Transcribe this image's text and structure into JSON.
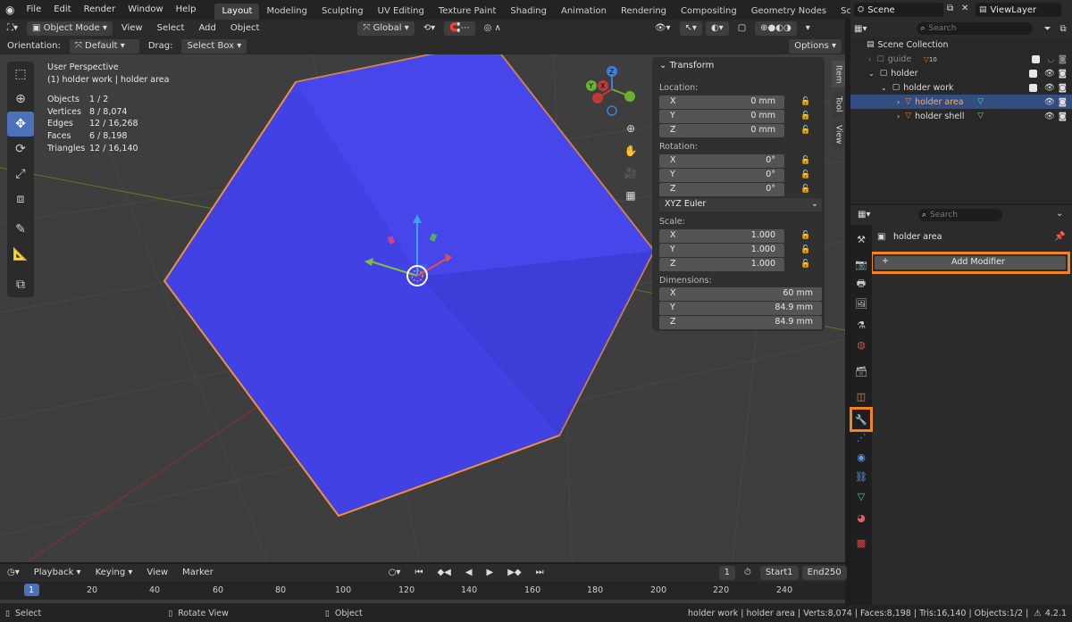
{
  "menu": {
    "items": [
      "File",
      "Edit",
      "Render",
      "Window",
      "Help"
    ],
    "workspaces": [
      "Layout",
      "Modeling",
      "Sculpting",
      "UV Editing",
      "Texture Paint",
      "Shading",
      "Animation",
      "Rendering",
      "Compositing",
      "Geometry Nodes",
      "Scripting"
    ],
    "active_workspace": "Layout",
    "add_tab": "+",
    "scene": "Scene",
    "view_layer": "ViewLayer"
  },
  "viewport_header": {
    "mode": "Object Mode",
    "view": "View",
    "select": "Select",
    "add": "Add",
    "object": "Object",
    "transform_orientation": "Global",
    "orientation_label": "Orientation:",
    "orientation_value": "Default",
    "drag_label": "Drag:",
    "drag_value": "Select Box",
    "options": "Options"
  },
  "viewport_info": {
    "perspective": "User Perspective",
    "context": "(1) holder work | holder area",
    "stats": [
      {
        "k": "Objects",
        "v": "1 / 2"
      },
      {
        "k": "Vertices",
        "v": "8 / 8,074"
      },
      {
        "k": "Edges",
        "v": "12 / 16,268"
      },
      {
        "k": "Faces",
        "v": "6 / 8,198"
      },
      {
        "k": "Triangles",
        "v": "12 / 16,140"
      }
    ]
  },
  "gizmo": {
    "x": "X",
    "y": "Y",
    "z": "Z"
  },
  "transform_panel": {
    "title": "Transform",
    "location_label": "Location:",
    "location": [
      {
        "axis": "X",
        "value": "0 mm"
      },
      {
        "axis": "Y",
        "value": "0 mm"
      },
      {
        "axis": "Z",
        "value": "0 mm"
      }
    ],
    "rotation_label": "Rotation:",
    "rotation": [
      {
        "axis": "X",
        "value": "0°"
      },
      {
        "axis": "Y",
        "value": "0°"
      },
      {
        "axis": "Z",
        "value": "0°"
      }
    ],
    "rotation_mode": "XYZ Euler",
    "scale_label": "Scale:",
    "scale": [
      {
        "axis": "X",
        "value": "1.000"
      },
      {
        "axis": "Y",
        "value": "1.000"
      },
      {
        "axis": "Z",
        "value": "1.000"
      }
    ],
    "dimensions_label": "Dimensions:",
    "dimensions": [
      {
        "axis": "X",
        "value": "60 mm"
      },
      {
        "axis": "Y",
        "value": "84.9 mm"
      },
      {
        "axis": "Z",
        "value": "84.9 mm"
      }
    ]
  },
  "side_tabs": [
    "Item",
    "Tool",
    "View"
  ],
  "outliner": {
    "search_placeholder": "Search",
    "rows": [
      {
        "label": "Scene Collection"
      },
      {
        "label": "guide",
        "badge": "10"
      },
      {
        "label": "holder"
      },
      {
        "label": "holder work"
      },
      {
        "label": "holder area"
      },
      {
        "label": "holder shell"
      }
    ]
  },
  "properties": {
    "search_placeholder": "Search",
    "object_name": "holder area",
    "add_modifier": "Add Modifier",
    "add_plus": "+"
  },
  "timeline": {
    "playback": "Playback",
    "keying": "Keying",
    "view": "View",
    "marker": "Marker",
    "current_frame": "1",
    "start_label": "Start",
    "start": "1",
    "end_label": "End",
    "end": "250",
    "ticks": [
      "1",
      "20",
      "40",
      "60",
      "80",
      "100",
      "120",
      "140",
      "160",
      "180",
      "200",
      "220",
      "240"
    ]
  },
  "statusbar": {
    "select": "Select",
    "rotate_view": "Rotate View",
    "object": "Object",
    "stats": "holder work | holder area | Verts:8,074 | Faces:8,198 | Tris:16,140 | Objects:1/2 |",
    "version": "4.2.1"
  },
  "colors": {
    "cube_fill": "#4040e0",
    "selection_outline": "#f0903a",
    "highlight_box": "#f58220",
    "active_tool": "#4b72b8",
    "selected_row": "#334d80"
  }
}
